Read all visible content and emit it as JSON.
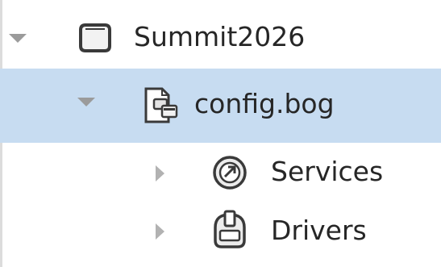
{
  "tree": {
    "items": [
      {
        "label": "Summit2026",
        "expanded": true,
        "selected": false,
        "icon": "station-icon"
      },
      {
        "label": "config.bog",
        "expanded": true,
        "selected": true,
        "icon": "bog-file-icon"
      },
      {
        "label": "Services",
        "expanded": false,
        "selected": false,
        "icon": "services-icon"
      },
      {
        "label": "Drivers",
        "expanded": false,
        "selected": false,
        "icon": "drivers-icon"
      }
    ],
    "colors": {
      "selection": "#c7dcf1",
      "text": "#262626",
      "expander": "#9b9b9b",
      "icon_stroke": "#3a3a3a",
      "icon_fill": "#e9e9e9"
    }
  }
}
